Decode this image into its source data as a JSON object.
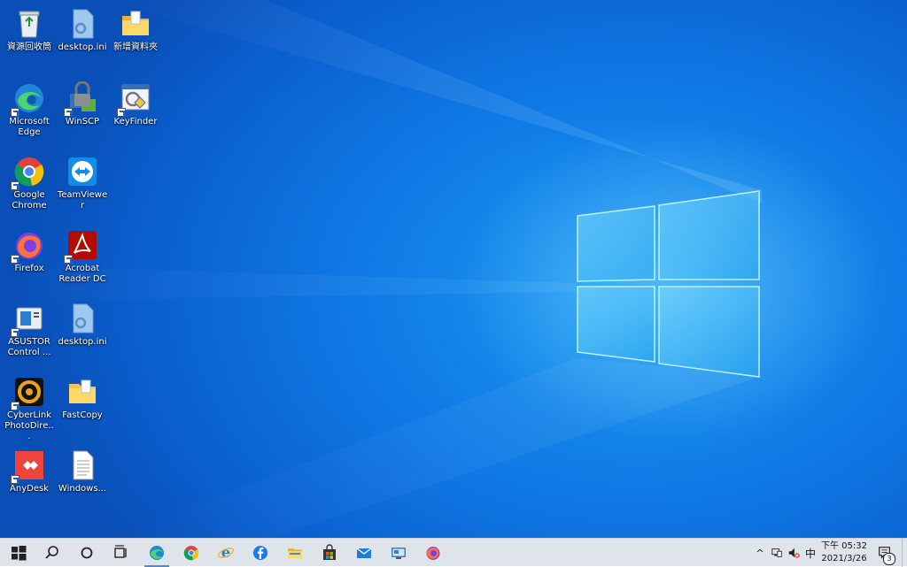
{
  "desktop": {
    "icons": [
      {
        "label": "資源回收筒",
        "name": "recycle-bin",
        "shortcut": false
      },
      {
        "label": "desktop.ini",
        "name": "desktop-ini",
        "shortcut": false
      },
      {
        "label": "新增資料夾",
        "name": "new-folder",
        "shortcut": false
      },
      {
        "label": "Microsoft Edge",
        "name": "microsoft-edge",
        "shortcut": true
      },
      {
        "label": "WinSCP",
        "name": "winscp",
        "shortcut": true
      },
      {
        "label": "KeyFinder",
        "name": "keyfinder",
        "shortcut": true
      },
      {
        "label": "Google Chrome",
        "name": "google-chrome",
        "shortcut": true
      },
      {
        "label": "TeamViewer",
        "name": "teamviewer",
        "shortcut": false
      },
      {
        "label": "Firefox",
        "name": "firefox",
        "shortcut": true
      },
      {
        "label": "Acrobat Reader DC",
        "name": "acrobat-reader",
        "shortcut": true
      },
      {
        "label": "ASUSTOR Control ...",
        "name": "asustor-control",
        "shortcut": true
      },
      {
        "label": "desktop.ini",
        "name": "desktop-ini-2",
        "shortcut": false
      },
      {
        "label": "CyberLink PhotoDire...",
        "name": "cyberlink-photodirector",
        "shortcut": true
      },
      {
        "label": "FastCopy",
        "name": "fastcopy",
        "shortcut": false
      },
      {
        "label": "AnyDesk",
        "name": "anydesk",
        "shortcut": true
      },
      {
        "label": "Windows...",
        "name": "windows-file",
        "shortcut": false
      }
    ]
  },
  "taskbar": {
    "buttons": [
      {
        "name": "start",
        "icon": "windows-logo-icon"
      },
      {
        "name": "search",
        "icon": "search-icon"
      },
      {
        "name": "cortana",
        "icon": "cortana-circle-icon"
      },
      {
        "name": "task-view",
        "icon": "task-view-icon"
      },
      {
        "name": "edge",
        "icon": "edge-icon"
      },
      {
        "name": "chrome",
        "icon": "chrome-icon"
      },
      {
        "name": "internet-explorer",
        "icon": "ie-icon"
      },
      {
        "name": "facebook",
        "icon": "facebook-icon"
      },
      {
        "name": "file-explorer",
        "icon": "folder-icon"
      },
      {
        "name": "store",
        "icon": "store-bag-icon"
      },
      {
        "name": "mail",
        "icon": "mail-icon"
      },
      {
        "name": "remote-desktop",
        "icon": "remote-desktop-icon"
      },
      {
        "name": "firefox",
        "icon": "firefox-icon"
      }
    ],
    "tray": {
      "chevron": "^",
      "ime": "中",
      "time": "下午 05:32",
      "date": "2021/3/26",
      "notification_count": "3"
    }
  },
  "colors": {
    "taskbar_bg": "#dfe3ea",
    "wallpaper_blue": "#0f7ae6",
    "accent": "#4a8bd8"
  }
}
